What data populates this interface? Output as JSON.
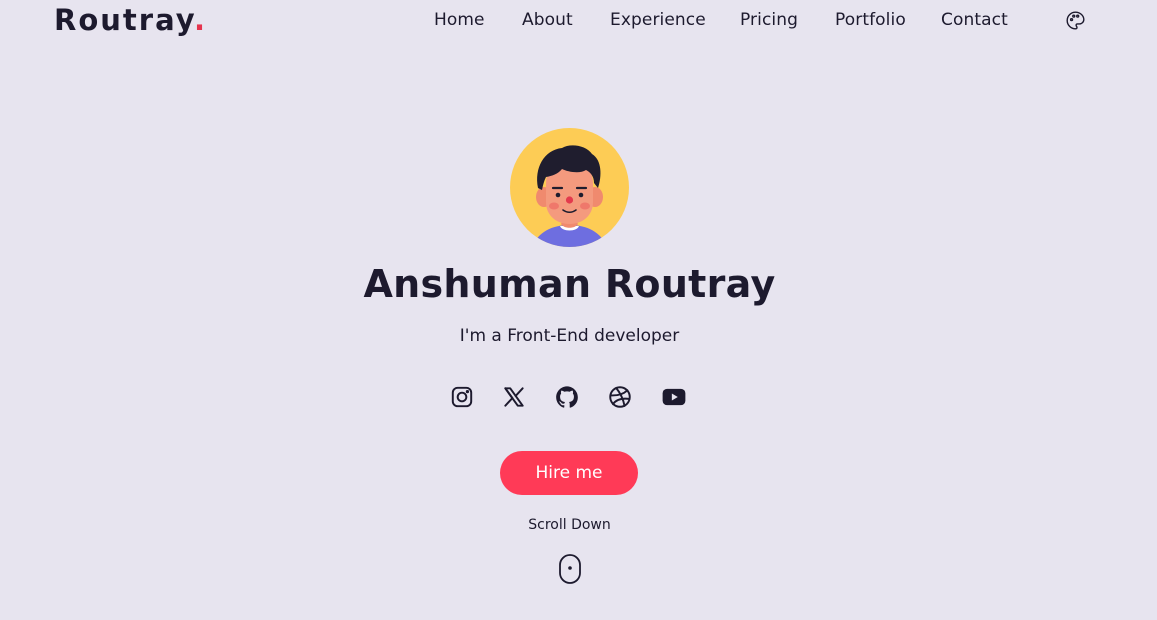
{
  "brand": {
    "name": "Routray",
    "dot": ".",
    "accent_color": "#e5344e"
  },
  "nav": {
    "items": [
      {
        "label": "Home"
      },
      {
        "label": "About"
      },
      {
        "label": "Experience"
      },
      {
        "label": "Pricing"
      },
      {
        "label": "Portfolio"
      },
      {
        "label": "Contact"
      }
    ],
    "theme_icon": "palette-icon"
  },
  "hero": {
    "name": "Anshuman Routray",
    "subtitle": "I'm a Front-End developer",
    "avatar_bg": "#fdcc55",
    "social": [
      {
        "icon": "instagram-icon"
      },
      {
        "icon": "x-twitter-icon"
      },
      {
        "icon": "github-icon"
      },
      {
        "icon": "dribbble-icon"
      },
      {
        "icon": "youtube-icon"
      }
    ],
    "cta_label": "Hire me",
    "cta_color": "#ff3a57",
    "scroll_label": "Scroll Down",
    "scroll_icon": "mouse-icon"
  },
  "colors": {
    "background": "#e7e4ef",
    "text": "#1d1a2e"
  }
}
